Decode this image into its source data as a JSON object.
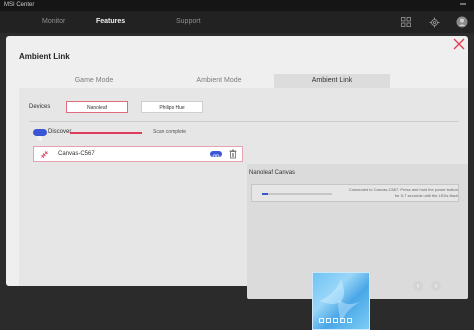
{
  "app": {
    "title": "MSI Center"
  },
  "nav": {
    "tabs": [
      {
        "label": "Monitor"
      },
      {
        "label": "Features"
      },
      {
        "label": "Support"
      }
    ]
  },
  "page": {
    "title": "Ambient Link"
  },
  "mode_tabs": [
    {
      "label": "Game Mode"
    },
    {
      "label": "Ambient Mode"
    },
    {
      "label": "Ambient Link"
    }
  ],
  "devices": {
    "label": "Devices",
    "buttons": [
      {
        "label": "Nanoleaf"
      },
      {
        "label": "Philips Hue"
      }
    ]
  },
  "discover": {
    "label": "Discover",
    "status": "Scan complete"
  },
  "device_list": [
    {
      "name": "Canvas-C567"
    }
  ],
  "canvas_panel": {
    "title": "Nanoleaf Canvas",
    "message": "Connected to Canvas-C567. Press and hold the power button for 5-7 seconds until the LEDs flash",
    "progress": 0.08
  },
  "colors": {
    "accent_blue": "#3a56d4",
    "accent_red": "#dd3c5a",
    "close_red": "#e23c55"
  },
  "icons": {
    "grid": "grid-icon",
    "settings": "gear-icon",
    "user": "user-icon",
    "close": "close-icon",
    "link": "link-icon",
    "trash": "trash-icon",
    "prev": "chevron-left-icon",
    "next": "chevron-right-icon"
  }
}
